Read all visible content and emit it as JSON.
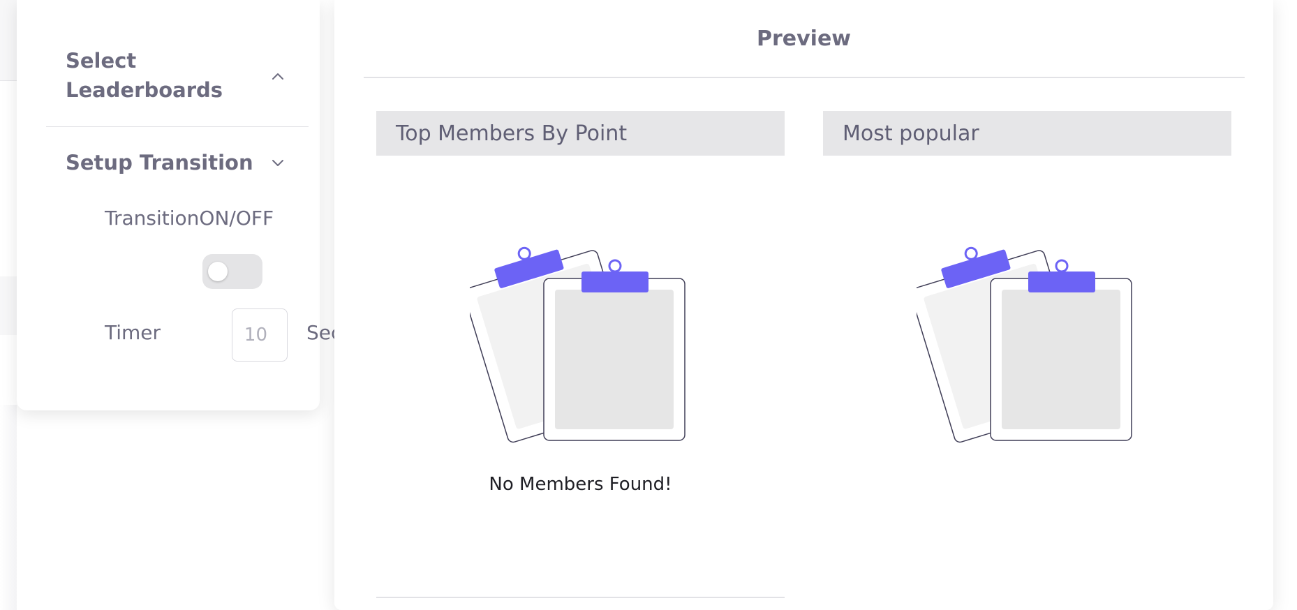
{
  "settings": {
    "select_leaderboards": "Select\nLeaderboards",
    "select_leaderboards_line1": "Select",
    "select_leaderboards_line2": "Leaderboards",
    "setup_transition": "Setup Transition",
    "transition_label": "TransitionON/OFF",
    "transition_on": false,
    "timer_label": "Timer",
    "timer_value": "10",
    "timer_unit": "Sec"
  },
  "preview": {
    "title": "Preview",
    "boards": [
      {
        "title": "Top Members By Point",
        "empty_text": "No Members Found!"
      },
      {
        "title": "Most popular",
        "empty_text": ""
      }
    ]
  },
  "colors": {
    "accent": "#6c63f5",
    "header_bg": "#e6e6e8",
    "text": "#6c6b7f"
  },
  "icons": {
    "select_leaderboards_toggle": "chevron-up-icon",
    "setup_transition_toggle": "chevron-down-icon",
    "empty_state": "clipboard-empty-icon"
  }
}
